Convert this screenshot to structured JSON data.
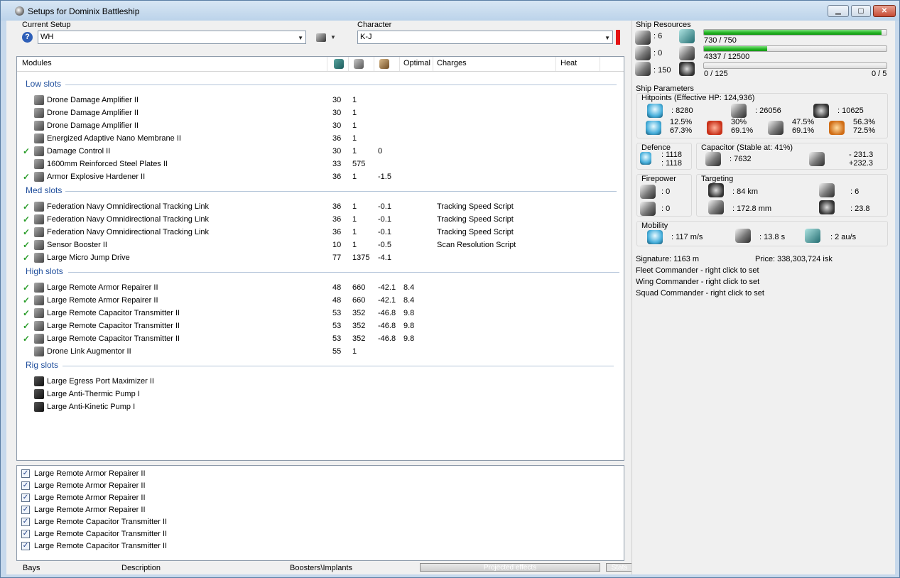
{
  "window": {
    "title": "Setups for Dominix Battleship"
  },
  "setup": {
    "label": "Current Setup",
    "value": "WH"
  },
  "character": {
    "label": "Character",
    "value": "K-J"
  },
  "modules_grid": {
    "headers": {
      "modules": "Modules",
      "optimal": "Optimal",
      "charges": "Charges",
      "heat": "Heat"
    },
    "low_label": "Low slots",
    "low": [
      {
        "name": "Drone Damage Amplifier II",
        "cpu": "30",
        "pg": "1",
        "cap": "",
        "opt": "",
        "charge": "",
        "active": false
      },
      {
        "name": "Drone Damage Amplifier II",
        "cpu": "30",
        "pg": "1",
        "cap": "",
        "opt": "",
        "charge": "",
        "active": false
      },
      {
        "name": "Drone Damage Amplifier II",
        "cpu": "30",
        "pg": "1",
        "cap": "",
        "opt": "",
        "charge": "",
        "active": false
      },
      {
        "name": "Energized Adaptive Nano Membrane II",
        "cpu": "36",
        "pg": "1",
        "cap": "",
        "opt": "",
        "charge": "",
        "active": false
      },
      {
        "name": "Damage Control II",
        "cpu": "30",
        "pg": "1",
        "cap": "0",
        "opt": "",
        "charge": "",
        "active": true
      },
      {
        "name": "1600mm Reinforced Steel Plates II",
        "cpu": "33",
        "pg": "575",
        "cap": "",
        "opt": "",
        "charge": "",
        "active": false
      },
      {
        "name": "Armor Explosive Hardener II",
        "cpu": "36",
        "pg": "1",
        "cap": "-1.5",
        "opt": "",
        "charge": "",
        "active": true
      }
    ],
    "med_label": "Med slots",
    "med": [
      {
        "name": "Federation Navy Omnidirectional Tracking Link",
        "cpu": "36",
        "pg": "1",
        "cap": "-0.1",
        "opt": "",
        "charge": "Tracking Speed Script",
        "active": true
      },
      {
        "name": "Federation Navy Omnidirectional Tracking Link",
        "cpu": "36",
        "pg": "1",
        "cap": "-0.1",
        "opt": "",
        "charge": "Tracking Speed Script",
        "active": true
      },
      {
        "name": "Federation Navy Omnidirectional Tracking Link",
        "cpu": "36",
        "pg": "1",
        "cap": "-0.1",
        "opt": "",
        "charge": "Tracking Speed Script",
        "active": true
      },
      {
        "name": "Sensor Booster II",
        "cpu": "10",
        "pg": "1",
        "cap": "-0.5",
        "opt": "",
        "charge": "Scan Resolution Script",
        "active": true
      },
      {
        "name": "Large Micro Jump Drive",
        "cpu": "77",
        "pg": "1375",
        "cap": "-4.1",
        "opt": "",
        "charge": "",
        "active": true
      }
    ],
    "high_label": "High slots",
    "high": [
      {
        "name": "Large Remote Armor Repairer II",
        "cpu": "48",
        "pg": "660",
        "cap": "-42.1",
        "opt": "8.4",
        "charge": "",
        "active": true
      },
      {
        "name": "Large Remote Armor Repairer II",
        "cpu": "48",
        "pg": "660",
        "cap": "-42.1",
        "opt": "8.4",
        "charge": "",
        "active": true
      },
      {
        "name": "Large Remote Capacitor Transmitter II",
        "cpu": "53",
        "pg": "352",
        "cap": "-46.8",
        "opt": "9.8",
        "charge": "",
        "active": true
      },
      {
        "name": "Large Remote Capacitor Transmitter II",
        "cpu": "53",
        "pg": "352",
        "cap": "-46.8",
        "opt": "9.8",
        "charge": "",
        "active": true
      },
      {
        "name": "Large Remote Capacitor Transmitter II",
        "cpu": "53",
        "pg": "352",
        "cap": "-46.8",
        "opt": "9.8",
        "charge": "",
        "active": true
      },
      {
        "name": "Drone Link Augmentor II",
        "cpu": "55",
        "pg": "1",
        "cap": "",
        "opt": "",
        "charge": "",
        "active": false
      }
    ],
    "rig_label": "Rig slots",
    "rig": [
      {
        "name": "Large Egress Port Maximizer II"
      },
      {
        "name": "Large Anti-Thermic Pump I"
      },
      {
        "name": "Large Anti-Kinetic Pump I"
      }
    ]
  },
  "projected": [
    "Large Remote Armor Repairer II",
    "Large Remote Armor Repairer II",
    "Large Remote Armor Repairer II",
    "Large Remote Armor Repairer II",
    "Large Remote Capacitor Transmitter II",
    "Large Remote Capacitor Transmitter II",
    "Large Remote Capacitor Transmitter II"
  ],
  "bottom_tabs": {
    "bays": "Bays",
    "description": "Description",
    "boosters": "Boosters\\Implants",
    "projected": "Projected effects",
    "stats": "Stats"
  },
  "resources": {
    "title": "Ship Resources",
    "high_slots": ": 6",
    "turrets": ": 0",
    "calibration": ": 150",
    "cpu": {
      "text": "730 / 750",
      "fraction": 0.973
    },
    "pg": {
      "text": "4337 / 12500",
      "fraction": 0.347
    },
    "drones_text": "0 / 125",
    "drones_fraction": 0,
    "drones_count": "0 / 5"
  },
  "params": {
    "title": "Ship Parameters",
    "hp_title": "Hitpoints (Effective HP: 124,936)",
    "shield_hp": ": 8280",
    "armor_hp": ": 26056",
    "hull_hp": ": 10625",
    "res_em": [
      "12.5%",
      "67.3%"
    ],
    "res_therm": [
      "30%",
      "69.1%"
    ],
    "res_kin": [
      "47.5%",
      "69.1%"
    ],
    "res_exp": [
      "56.3%",
      "72.5%"
    ],
    "defence_title": "Defence",
    "defence": [
      ": 1118",
      ": 1118"
    ],
    "cap_title": "Capacitor (Stable at: 41%)",
    "cap_amount": ": 7632",
    "cap_delta": [
      "- 231.3",
      "+232.3"
    ],
    "fire_title": "Firepower",
    "fire": [
      ": 0",
      ": 0"
    ],
    "target_title": "Targeting",
    "range": ": 84 km",
    "targets": ": 6",
    "scanres": ": 172.8 mm",
    "sensor": ": 23.8",
    "mob_title": "Mobility",
    "speed": ": 117 m/s",
    "align": ": 13.8 s",
    "warp": ": 2 au/s"
  },
  "info": {
    "signature": "Signature: 1163 m",
    "price": "Price: 338,303,724 isk",
    "fleet": "Fleet Commander - right click to set",
    "wing": "Wing Commander - right click to set",
    "squad": "Squad Commander - right click to set"
  }
}
